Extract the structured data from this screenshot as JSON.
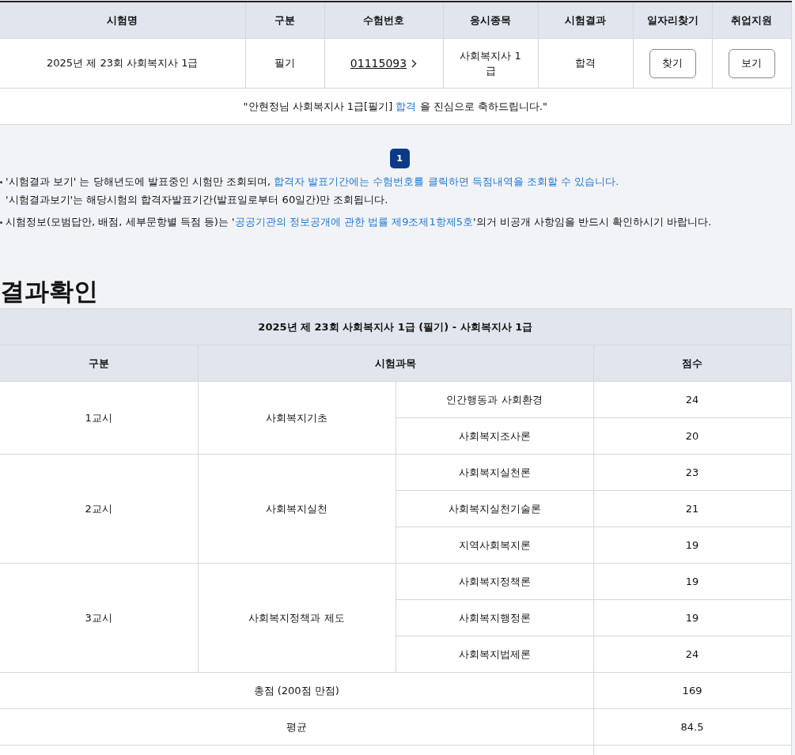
{
  "result_table": {
    "columns": [
      "시험명",
      "구분",
      "수험번호",
      "응시종목",
      "시험결과",
      "일자리찾기",
      "취업지원"
    ],
    "row": {
      "exam_name": "2025년 제 23회 사회복지사 1급",
      "type": "필기",
      "exam_number": "01115093",
      "category": "사회복지사 1급",
      "result": "합격",
      "find_job_button": "찾기",
      "support_button": "보기"
    },
    "message": [
      {
        "text": "\"안현정님 사회복지사 1급[필기] ",
        "kind": "plain"
      },
      {
        "text": "합격",
        "kind": "link"
      },
      {
        "text": " 을 진심으로 축하드립니다.\"",
        "kind": "plain"
      }
    ]
  },
  "pagination": [
    {
      "label": "1",
      "selected": true
    }
  ],
  "notes": [
    {
      "bullet": true,
      "segments": [
        {
          "text": "'시험결과 보기' 는 당해년도에 발표중인 시험만 조회되며, ",
          "kind": "plain"
        },
        {
          "text": "합격자 발표기간에는 수험번호를 클릭하면 득점내역을 조회할 수 있습니다.",
          "kind": "link"
        }
      ]
    },
    {
      "bullet": false,
      "segments": [
        {
          "text": "'시험결과보기'는 해당시험의 합격자발표기간(발표일로부터 60일간)만 조회됩니다.",
          "kind": "plain"
        }
      ]
    },
    {
      "bullet": true,
      "segments": [
        {
          "text": "시험정보(모범답안, 배점, 세부문항별 득점 등)는 '",
          "kind": "plain"
        },
        {
          "text": "공공기관의 정보공개에 관한 법률 제9조제1항제5호",
          "kind": "link"
        },
        {
          "text": "'의거 비공개 사항임을 반드시 확인하시기 바랍니다.",
          "kind": "plain"
        }
      ]
    }
  ],
  "section_title": "결과확인",
  "score_table": {
    "title": "2025년 제 23회 사회복지사 1급 (필기) - 사회복지사 1급",
    "columns": [
      "구분",
      "시험과목",
      "점수"
    ],
    "periods": [
      {
        "period": "1교시",
        "area": "사회복지기초",
        "subjects": [
          {
            "name": "인간행동과 사회환경",
            "score": "24"
          },
          {
            "name": "사회복지조사론",
            "score": "20"
          }
        ]
      },
      {
        "period": "2교시",
        "area": "사회복지실천",
        "subjects": [
          {
            "name": "사회복지실천론",
            "score": "23"
          },
          {
            "name": "사회복지실천기술론",
            "score": "21"
          },
          {
            "name": "지역사회복지론",
            "score": "19"
          }
        ]
      },
      {
        "period": "3교시",
        "area": "사회복지정책과 제도",
        "subjects": [
          {
            "name": "사회복지정책론",
            "score": "19"
          },
          {
            "name": "사회복지행정론",
            "score": "19"
          },
          {
            "name": "사회복지법제론",
            "score": "24"
          }
        ]
      }
    ],
    "totals": [
      {
        "label": "총점 (200점 만점)",
        "value": "169"
      },
      {
        "label": "평균",
        "value": "84.5"
      }
    ]
  }
}
